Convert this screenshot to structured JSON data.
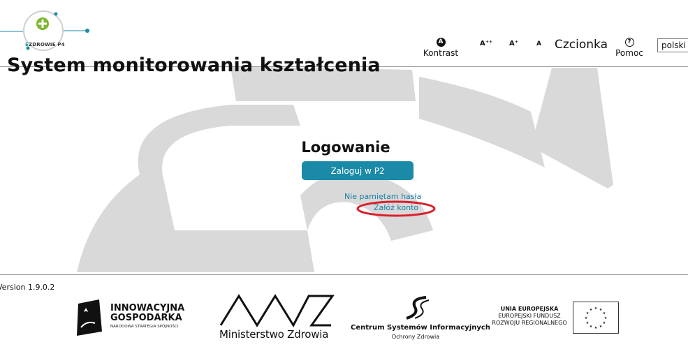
{
  "header": {
    "logo_text_prefix": "E",
    "logo_text_main": "ZDROWIE",
    "logo_text_suffix": "P4",
    "page_title": "System monitorowania kształcenia"
  },
  "toolbar": {
    "contrast_icon": "A",
    "contrast_label": "Kontrast",
    "font_large": "A⁺⁺",
    "font_medium": "A⁺",
    "font_small": "A",
    "font_label": "Czcionka",
    "help_icon": "?",
    "help_label": "Pomoc",
    "language_selected": "polski"
  },
  "login": {
    "title": "Logowanie",
    "login_button": "Zaloguj w P2",
    "forgot_password": "Nie pamiętam hasła",
    "create_account": "Załóż konto"
  },
  "footer": {
    "version": "Version 1.9.0.2",
    "ig_line1": "INNOWACYJNA",
    "ig_line2": "GOSPODARKA",
    "ig_sub": "NARODOWA STRATEGIA SPÓJNOŚCI",
    "mz_name": "Ministerstwo Zdrowia",
    "csi_name": "Centrum Systemów Informacyjnych",
    "csi_sub": "Ochrony Zdrowia",
    "ue_line1": "UNIA EUROPEJSKA",
    "ue_line2": "EUROPEJSKI FUNDUSZ",
    "ue_line3": "ROZWOJU REGIONALNEGO"
  },
  "colors": {
    "accent": "#1a8aa8",
    "link": "#1a7fa6",
    "annotation": "#d8202a",
    "watermark": "#d9d9d9"
  }
}
